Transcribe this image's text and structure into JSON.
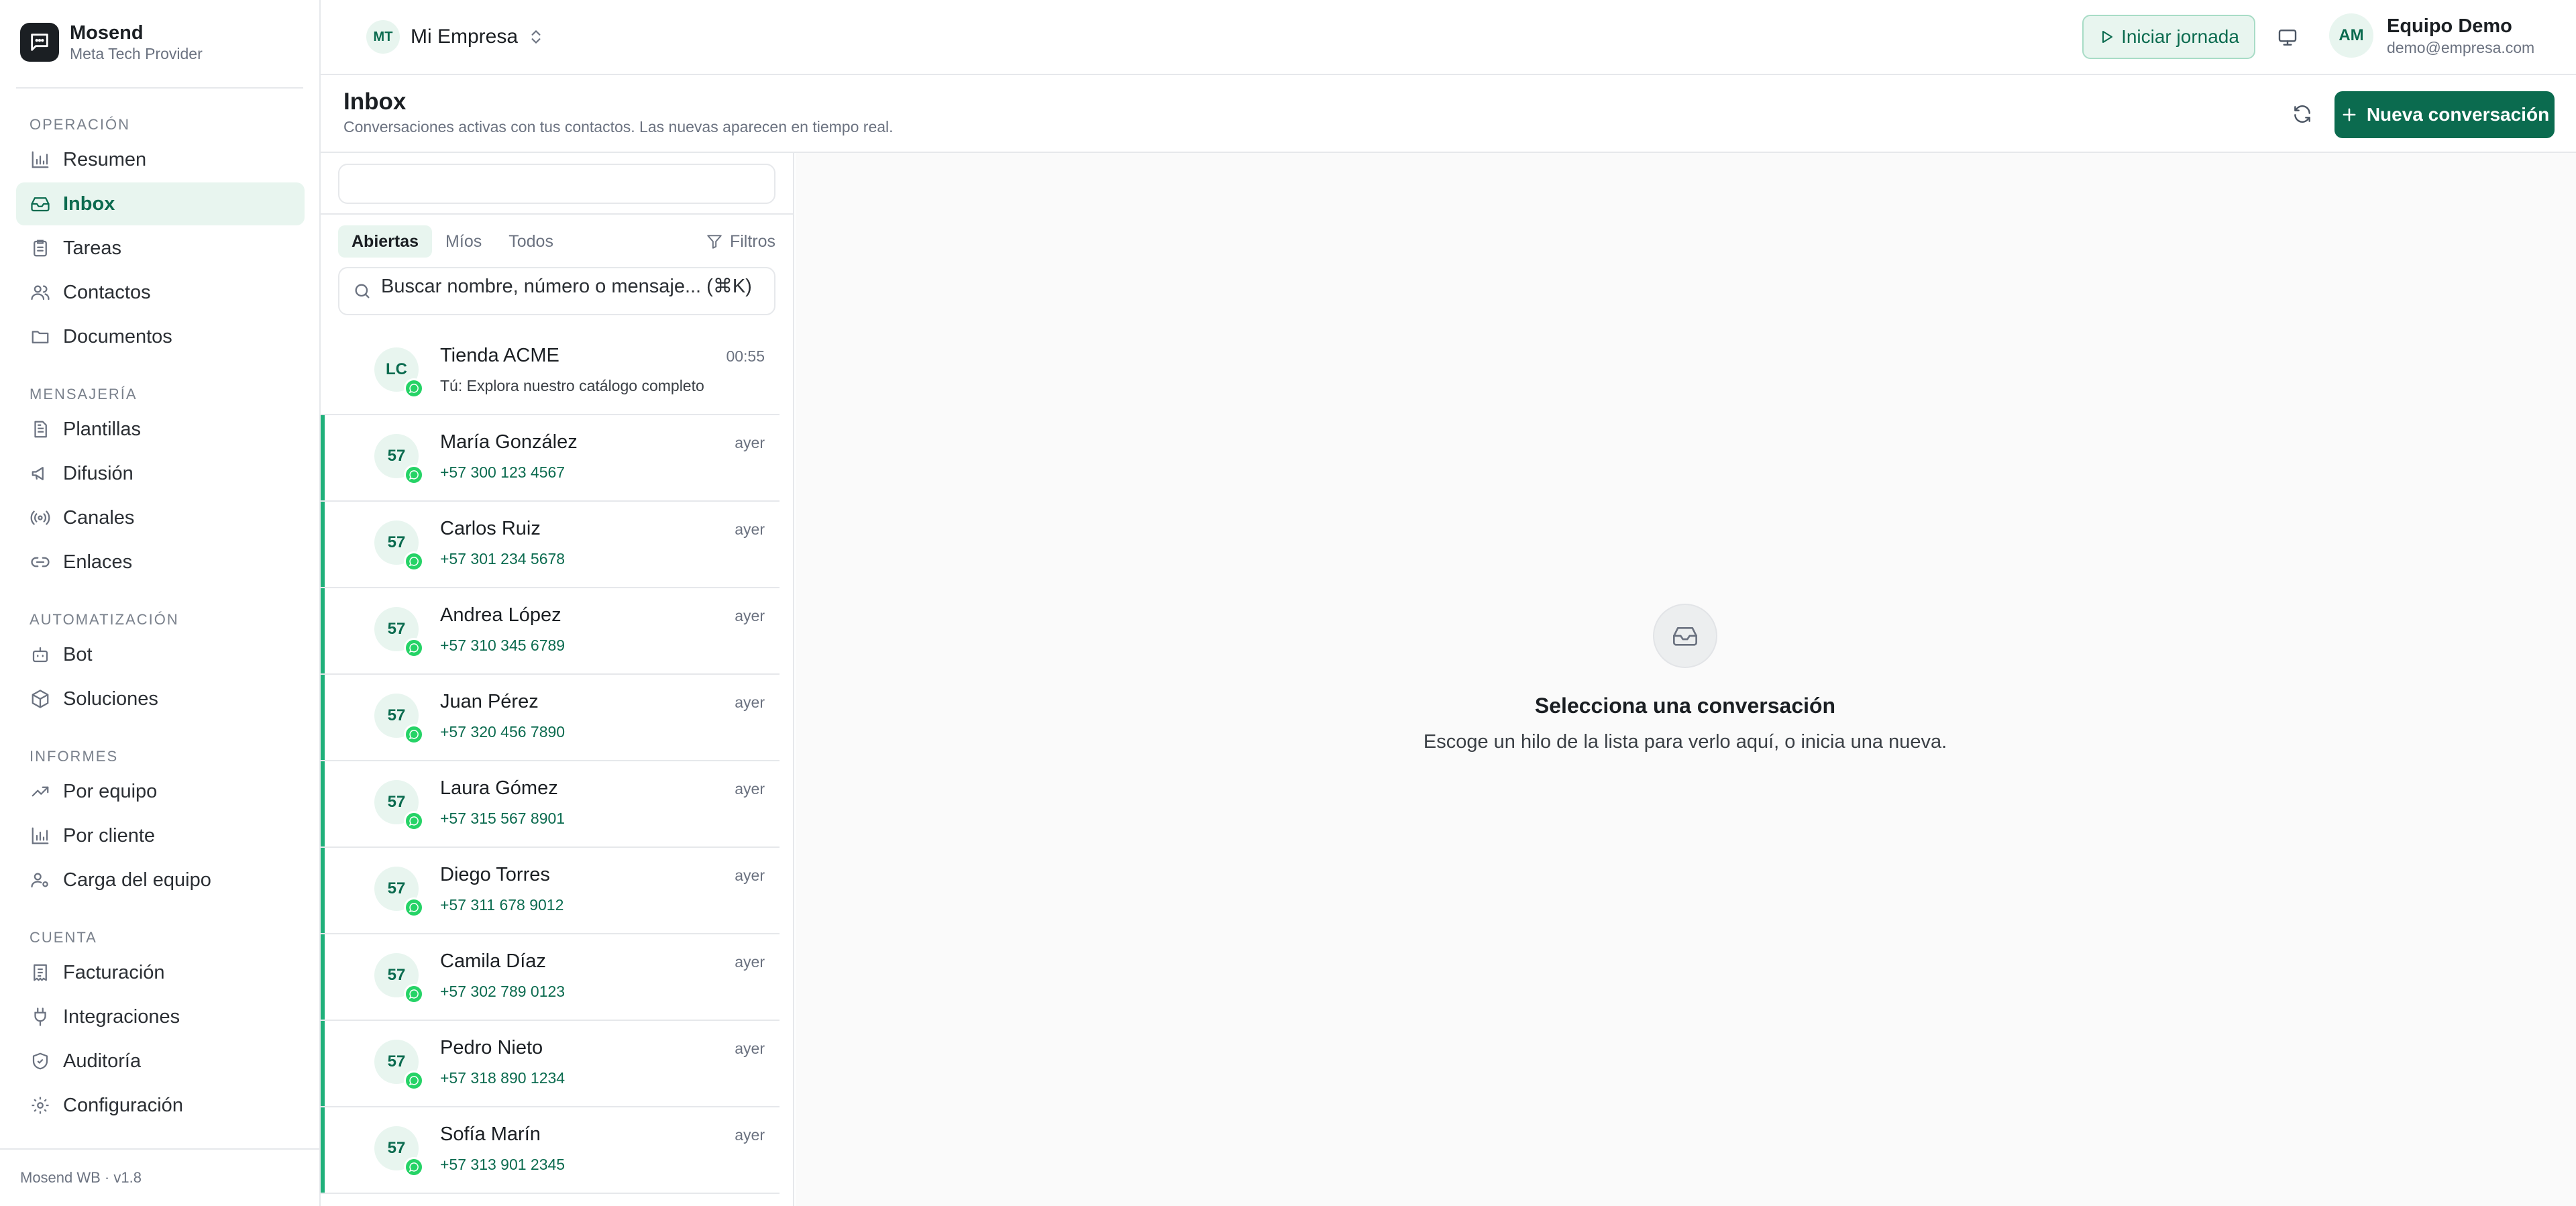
{
  "brand": {
    "name": "Mosend",
    "subtitle": "Meta Tech Provider"
  },
  "sidebar": {
    "sections": [
      {
        "title": "OPERACIÓN",
        "items": [
          {
            "label": "Resumen",
            "icon": "bar-chart-icon"
          },
          {
            "label": "Inbox",
            "icon": "inbox-icon",
            "active": true
          },
          {
            "label": "Tareas",
            "icon": "clipboard-icon"
          },
          {
            "label": "Contactos",
            "icon": "users-icon"
          },
          {
            "label": "Documentos",
            "icon": "folder-icon"
          }
        ]
      },
      {
        "title": "MENSAJERÍA",
        "items": [
          {
            "label": "Plantillas",
            "icon": "file-text-icon"
          },
          {
            "label": "Difusión",
            "icon": "megaphone-icon"
          },
          {
            "label": "Canales",
            "icon": "radio-icon"
          },
          {
            "label": "Enlaces",
            "icon": "link-icon"
          }
        ]
      },
      {
        "title": "AUTOMATIZACIÓN",
        "items": [
          {
            "label": "Bot",
            "icon": "bot-icon"
          },
          {
            "label": "Soluciones",
            "icon": "package-icon"
          }
        ]
      },
      {
        "title": "INFORMES",
        "items": [
          {
            "label": "Por equipo",
            "icon": "trending-up-icon"
          },
          {
            "label": "Por cliente",
            "icon": "bar-chart-icon"
          },
          {
            "label": "Carga del equipo",
            "icon": "user-cog-icon"
          }
        ]
      },
      {
        "title": "CUENTA",
        "items": [
          {
            "label": "Facturación",
            "icon": "receipt-icon"
          },
          {
            "label": "Integraciones",
            "icon": "plug-icon"
          },
          {
            "label": "Auditoría",
            "icon": "shield-icon"
          },
          {
            "label": "Configuración",
            "icon": "settings-icon"
          }
        ]
      }
    ],
    "footer": "Mosend WB · v1.8"
  },
  "topbar": {
    "company_initials": "MT",
    "company_name": "Mi Empresa",
    "start_shift_label": "Iniciar jornada",
    "user_initials": "AM",
    "user_name": "Equipo Demo",
    "user_email": "demo@empresa.com"
  },
  "page": {
    "title": "Inbox",
    "subtitle": "Conversaciones activas con tus contactos. Las nuevas aparecen en tiempo real.",
    "new_conversation_label": "Nueva conversación"
  },
  "list": {
    "tabs": [
      "Abiertas",
      "Míos",
      "Todos"
    ],
    "active_tab": "Abiertas",
    "filters_label": "Filtros",
    "search_placeholder": "Buscar nombre, número o mensaje... (⌘K)",
    "conversations": [
      {
        "initials": "LC",
        "name": "Tienda ACME",
        "time": "00:55",
        "preview": "Tú: Explora nuestro catálogo completo",
        "is_message": true
      },
      {
        "initials": "57",
        "name": "María González",
        "time": "ayer",
        "preview": "+57 300 123 4567"
      },
      {
        "initials": "57",
        "name": "Carlos Ruiz",
        "time": "ayer",
        "preview": "+57 301 234 5678"
      },
      {
        "initials": "57",
        "name": "Andrea López",
        "time": "ayer",
        "preview": "+57 310 345 6789"
      },
      {
        "initials": "57",
        "name": "Juan Pérez",
        "time": "ayer",
        "preview": "+57 320 456 7890"
      },
      {
        "initials": "57",
        "name": "Laura Gómez",
        "time": "ayer",
        "preview": "+57 315 567 8901"
      },
      {
        "initials": "57",
        "name": "Diego Torres",
        "time": "ayer",
        "preview": "+57 311 678 9012"
      },
      {
        "initials": "57",
        "name": "Camila Díaz",
        "time": "ayer",
        "preview": "+57 302 789 0123"
      },
      {
        "initials": "57",
        "name": "Pedro Nieto",
        "time": "ayer",
        "preview": "+57 318 890 1234"
      },
      {
        "initials": "57",
        "name": "Sofía Marín",
        "time": "ayer",
        "preview": "+57 313 901 2345"
      }
    ]
  },
  "empty_state": {
    "title": "Selecciona una conversación",
    "subtitle": "Escoge un hilo de la lista para verlo aquí, o inicia una nueva."
  },
  "colors": {
    "accent": "#0b6b4f",
    "accent_soft": "#e8f5ef",
    "whatsapp": "#25d366"
  }
}
